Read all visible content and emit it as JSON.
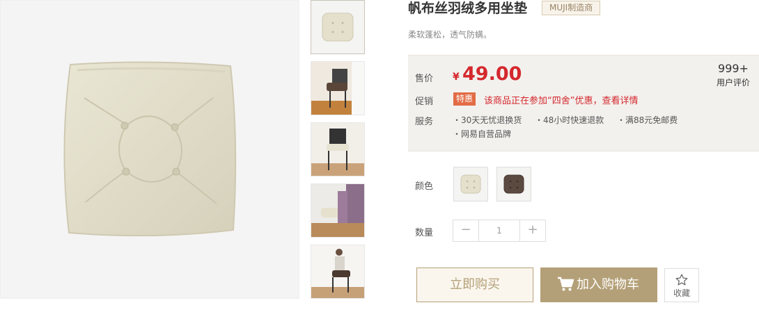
{
  "product": {
    "title": "帆布丝羽绒多用坐垫",
    "brand_tag": "MUJI制造商",
    "subtitle": "柔软蓬松，透气防螨。"
  },
  "price": {
    "label": "售价",
    "currency": "¥",
    "value": "49.00"
  },
  "reviews": {
    "count": "999+",
    "label": "用户评价"
  },
  "promotion": {
    "label": "促销",
    "badge": "特惠",
    "text": "该商品正在参加“四舍”优惠，查看详情"
  },
  "service": {
    "label": "服务",
    "items": [
      "・30天无忧退换货",
      "・48小时快速退款",
      "・满88元免邮费",
      "・网易自营品牌"
    ]
  },
  "color": {
    "label": "颜色",
    "options": [
      "beige",
      "brown"
    ]
  },
  "quantity": {
    "label": "数量",
    "minus": "−",
    "value": "1",
    "plus": "+"
  },
  "actions": {
    "buy_now": "立即购买",
    "add_cart": "加入购物车",
    "favorite": "收藏"
  },
  "colors": {
    "accent": "#b4a078",
    "price": "#d4282d",
    "promo_badge": "#e26b45"
  }
}
